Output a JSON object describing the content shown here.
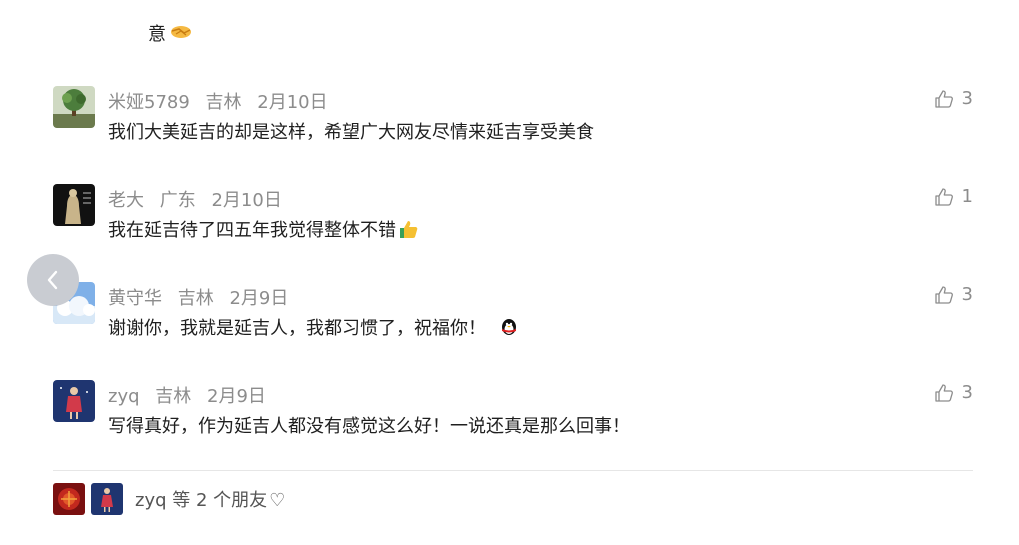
{
  "top_text": "意",
  "comments": [
    {
      "user": "米娅5789",
      "location": "吉林",
      "date": "2月10日",
      "text": "我们大美延吉的却是这样，希望广大网友尽情来延吉享受美食",
      "likes": "3"
    },
    {
      "user": "老大",
      "location": "广东",
      "date": "2月10日",
      "text": "我在延吉待了四五年我觉得整体不错",
      "likes": "1"
    },
    {
      "user": "黄守华",
      "location": "吉林",
      "date": "2月9日",
      "text": "谢谢你，我就是延吉人，我都习惯了，祝福你！",
      "likes": "3"
    },
    {
      "user": "zyq",
      "location": "吉林",
      "date": "2月9日",
      "text": "写得真好，作为延吉人都没有感觉这么好！一说还真是那么回事！",
      "likes": "3"
    }
  ],
  "friends_liked": {
    "name": "zyq",
    "suffix": "等 2 个朋友",
    "heart": "♡"
  },
  "colors": {
    "meta": "#8c8c8c",
    "text": "#1f1f1f",
    "nav_button": "#c9ccd2",
    "divider": "#e6e6e6"
  },
  "icons": [
    "handshake-emoji",
    "thumbs-up-icon",
    "chevron-left-icon",
    "penguin-emoji",
    "heart-outline-icon"
  ]
}
